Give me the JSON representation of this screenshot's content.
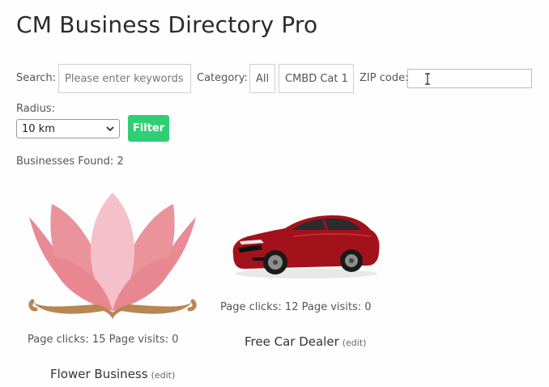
{
  "page": {
    "title": "CM Business Directory Pro"
  },
  "filters": {
    "search_label": "Search:",
    "search_placeholder": "Please enter keywords",
    "category_label": "Category:",
    "category_all": "All",
    "category_cat1": "CMBD Cat 1",
    "zip_label": "ZIP code:",
    "zip_value": "",
    "radius_label": "Radius:",
    "radius_value": "10 km",
    "filter_button": "Filter"
  },
  "results": {
    "count_text": "Businesses Found: 2",
    "businesses": [
      {
        "name": "Flower Business",
        "edit": "(edit)",
        "stats": "Page clicks: 15 Page visits: 0",
        "image": "lotus-flower"
      },
      {
        "name": "Free Car Dealer",
        "edit": "(edit)",
        "stats": "Page clicks: 12 Page visits: 0",
        "image": "red-coupe-car"
      }
    ]
  },
  "colors": {
    "filter_button": "#2fcf76",
    "lotus_petal": "#e0606c",
    "lotus_hands": "#b78653",
    "car_body": "#a3121b"
  }
}
